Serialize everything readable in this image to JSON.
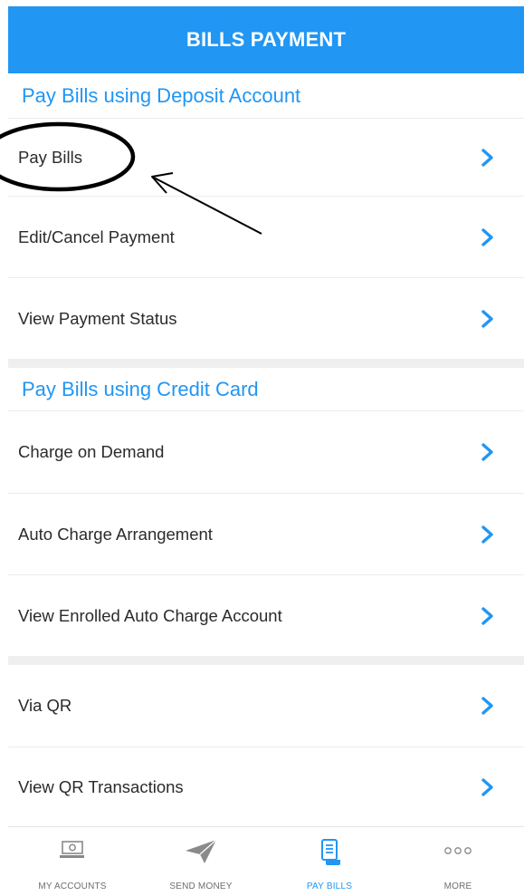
{
  "header": {
    "title": "BILLS PAYMENT"
  },
  "sections": {
    "deposit": {
      "title": "Pay Bills using Deposit Account",
      "items": [
        {
          "label": "Pay Bills"
        },
        {
          "label": "Edit/Cancel Payment"
        },
        {
          "label": "View Payment Status"
        }
      ]
    },
    "credit": {
      "title": "Pay Bills using Credit Card",
      "items": [
        {
          "label": "Charge on Demand"
        },
        {
          "label": "Auto Charge Arrangement"
        },
        {
          "label": "View Enrolled Auto Charge Account"
        }
      ]
    },
    "qr": {
      "items": [
        {
          "label": "Via QR"
        },
        {
          "label": "View QR Transactions"
        }
      ]
    }
  },
  "tabbar": {
    "tabs": [
      {
        "label": "MY ACCOUNTS",
        "icon": "cash-icon"
      },
      {
        "label": "SEND MONEY",
        "icon": "paper-plane-icon"
      },
      {
        "label": "PAY BILLS",
        "icon": "bill-receipt-icon",
        "active": true
      },
      {
        "label": "MORE",
        "icon": "more-dots-icon"
      }
    ]
  },
  "colors": {
    "accent": "#2196f3",
    "text": "#2b2b2b",
    "muted": "#6d6d6d"
  }
}
